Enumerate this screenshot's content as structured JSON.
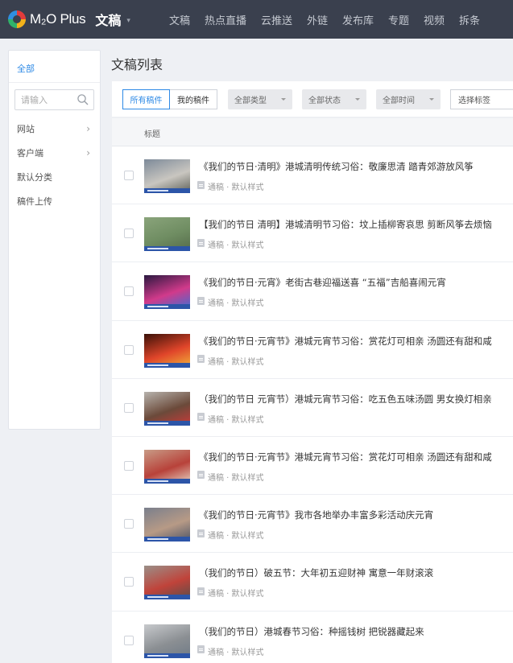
{
  "header": {
    "logo_text": "M₂O Plus",
    "module_title": "文稿",
    "module_caret": "▾",
    "nav": [
      "文稿",
      "热点直播",
      "云推送",
      "外链",
      "发布库",
      "专题",
      "视频",
      "拆条"
    ]
  },
  "sidebar": {
    "all_label": "全部",
    "search_placeholder": "请输入",
    "items": [
      {
        "label": "网站",
        "chevron": "›"
      },
      {
        "label": "客户端",
        "chevron": "›"
      },
      {
        "label": "默认分类",
        "chevron": ""
      },
      {
        "label": "稿件上传",
        "chevron": ""
      }
    ]
  },
  "main": {
    "page_title": "文稿列表",
    "filters": {
      "all_drafts": "所有稿件",
      "my_drafts": "我的稿件",
      "type": "全部类型",
      "status": "全部状态",
      "time": "全部时间",
      "tags": "选择标签"
    },
    "table_header": "标题",
    "rows": [
      {
        "title": "《我们的节日·清明》港城清明传统习俗：敬廉思清 踏青郊游放风筝",
        "meta": "通稿 · 默认样式",
        "thumb": [
          "#7d8a99",
          "#c9c6c0",
          "#5b5e56"
        ]
      },
      {
        "title": "【我们的节日 清明】港城清明节习俗：坟上插柳寄哀思 剪断风筝去烦恼",
        "meta": "通稿 · 默认样式",
        "thumb": [
          "#8aa47b",
          "#6f8d62",
          "#556b4a"
        ]
      },
      {
        "title": "《我们的节日·元宵》老街古巷迎福送喜 “五福”吉船喜闹元宵",
        "meta": "通稿 · 默认样式",
        "thumb": [
          "#2a1840",
          "#d13a8b",
          "#3d6fd4"
        ]
      },
      {
        "title": "《我们的节日·元宵节》港城元宵节习俗：赏花灯可相亲 汤圆还有甜和咸",
        "meta": "通稿 · 默认样式",
        "thumb": [
          "#3a1108",
          "#e0452a",
          "#f2b33a"
        ]
      },
      {
        "title": "（我们的节日 元宵节）港城元宵节习俗：吃五色五味汤圆 男女换灯相亲",
        "meta": "通稿 · 默认样式",
        "thumb": [
          "#b7b3ad",
          "#6b4a3a",
          "#c93a3a"
        ]
      },
      {
        "title": "《我们的节日·元宵节》港城元宵节习俗：赏花灯可相亲 汤圆还有甜和咸",
        "meta": "通稿 · 默认样式",
        "thumb": [
          "#c89b86",
          "#b8423a",
          "#e6d2c2"
        ]
      },
      {
        "title": "《我们的节日·元宵节》我市各地举办丰富多彩活动庆元宵",
        "meta": "通稿 · 默认样式",
        "thumb": [
          "#7a7f8c",
          "#b79a86",
          "#4d5566"
        ]
      },
      {
        "title": "（我们的节日）破五节：大年初五迎财神 寓意一年财滚滚",
        "meta": "通稿 · 默认样式",
        "thumb": [
          "#9a8f88",
          "#c0433a",
          "#5a4d48"
        ]
      },
      {
        "title": "（我们的节日）港城春节习俗：种摇钱树 把锐器藏起来",
        "meta": "通稿 · 默认样式",
        "thumb": [
          "#c7c9cc",
          "#8b8f93",
          "#6f7a86"
        ]
      }
    ]
  }
}
